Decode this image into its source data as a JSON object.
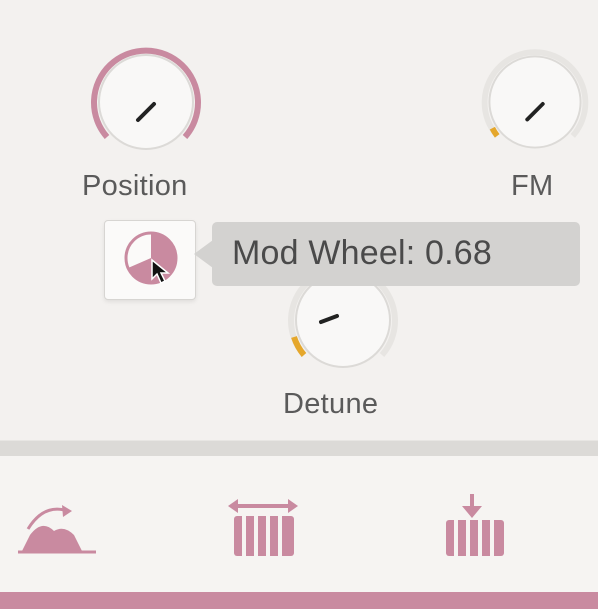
{
  "knobs": [
    {
      "label": "Position",
      "value": 0.62,
      "ring_color": "#c98aa0",
      "range": "full"
    },
    {
      "label": "FM",
      "value": 0.05,
      "ring_color": "#e5a72b",
      "range": "min"
    },
    {
      "label": "Detune",
      "value": 0.1,
      "ring_color": "#e5a72b",
      "range": "min"
    }
  ],
  "tooltip": {
    "text": "Mod Wheel: 0.68"
  },
  "mod_source": {
    "value": 0.68,
    "color": "#c98aa0"
  },
  "bottom_icons": [
    "mountain-glide-icon",
    "keyboard-spread-icon",
    "keyboard-target-icon"
  ],
  "colors": {
    "accent": "#c98aa0",
    "warning": "#e5a72b",
    "background": "#f3f1ef"
  }
}
